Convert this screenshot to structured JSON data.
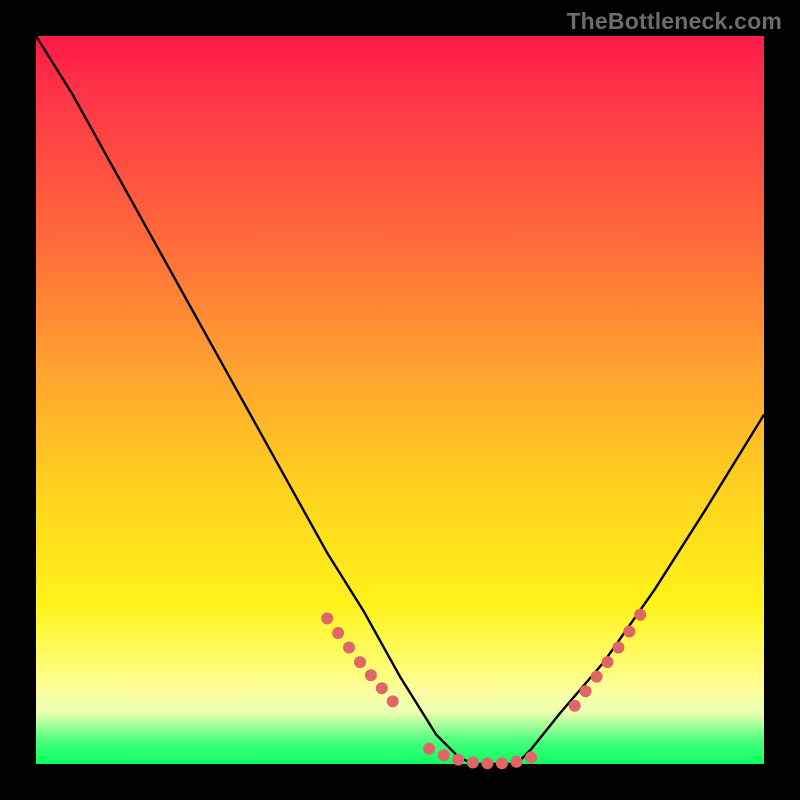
{
  "watermark": "TheBottleneck.com",
  "colors": {
    "background_frame": "#000000",
    "gradient_top": "#ff1a47",
    "gradient_mid1": "#ff6a3a",
    "gradient_mid2": "#ffd11f",
    "gradient_mid3": "#fff31a",
    "gradient_bottom": "#0aff62",
    "curve": "#000000",
    "markers": "#e06666"
  },
  "chart_data": {
    "type": "line",
    "title": "",
    "xlabel": "",
    "ylabel": "",
    "xlim": [
      0,
      100
    ],
    "ylim": [
      0,
      100
    ],
    "grid": false,
    "legend": false,
    "note": "Values are percentage bottleneck; y=0 is optimal (green band). V-shaped curve with flat minimum around x≈55–68.",
    "series": [
      {
        "name": "bottleneck_curve",
        "x": [
          0,
          5,
          10,
          15,
          20,
          25,
          30,
          35,
          40,
          45,
          50,
          55,
          58,
          60,
          62,
          64,
          66,
          68,
          72,
          78,
          85,
          92,
          100
        ],
        "y": [
          100,
          92,
          83,
          74,
          65,
          56,
          47,
          38,
          29,
          21,
          12,
          4,
          1,
          0,
          0,
          0,
          0,
          2,
          7,
          14,
          24,
          35,
          48
        ]
      }
    ],
    "markers": {
      "note": "Salmon dotted segments on the curve flanks near the bottom and along the flat minimum.",
      "points_x": [
        40,
        41.5,
        43,
        44.5,
        46,
        47.5,
        49,
        54,
        56,
        58,
        60,
        62,
        64,
        66,
        68,
        74,
        75.5,
        77,
        78.5,
        80,
        81.5,
        83
      ],
      "points_y": [
        20,
        18,
        16,
        14,
        12.2,
        10.4,
        8.6,
        2.1,
        1.2,
        0.6,
        0.2,
        0.1,
        0.1,
        0.3,
        0.9,
        8,
        10,
        12,
        14,
        16,
        18.2,
        20.5
      ]
    }
  }
}
